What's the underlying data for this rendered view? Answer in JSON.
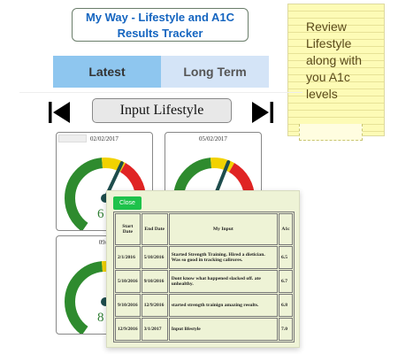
{
  "app": {
    "title": "My Way - Lifestyle and A1C Results Tracker"
  },
  "tabs": [
    {
      "label": "Latest"
    },
    {
      "label": "Long Term"
    }
  ],
  "nav": {
    "input_label": "Input Lifestyle"
  },
  "note": {
    "text": "Review Lifestyle along with you A1c levels"
  },
  "cards": [
    {
      "date": "02/02/2017",
      "value": "6",
      "level": 0.64
    },
    {
      "date": "05/02/2017",
      "value": "",
      "level": 0.62
    },
    {
      "date": "09/0",
      "value": "8",
      "level": 0.88
    }
  ],
  "modal": {
    "close_label": "Close",
    "headers": {
      "start": "Start Date",
      "end": "End Date",
      "input": "My Input",
      "a1c": "A1c"
    },
    "rows": [
      {
        "start": "2/1/2016",
        "end": "5/10/2016",
        "input": "Started Strength Training. Hired a dietician. Was so good in tracking calirores.",
        "a1c": "6.5"
      },
      {
        "start": "5/10/2016",
        "end": "9/10/2016",
        "input": "Dont know what happened slacked off. ate unhealthy.",
        "a1c": "6.7"
      },
      {
        "start": "9/10/2016",
        "end": "12/9/2016",
        "input": "started strength trainign amazing results.",
        "a1c": "6.8"
      },
      {
        "start": "12/9/2016",
        "end": "3/1/2017",
        "input": "Input lifestyle",
        "a1c": "7.0"
      }
    ]
  },
  "colors": {
    "accent": "#1565c0",
    "tab_active": "#8ec6ef",
    "tab_inactive": "#d4e4f7",
    "gauge_green": "#2e8b2e",
    "gauge_yellow": "#f2d200",
    "gauge_red": "#e02424",
    "needle": "#1e4d4d",
    "close_green": "#1ec24b",
    "note_yellow": "#fdfbb6"
  }
}
